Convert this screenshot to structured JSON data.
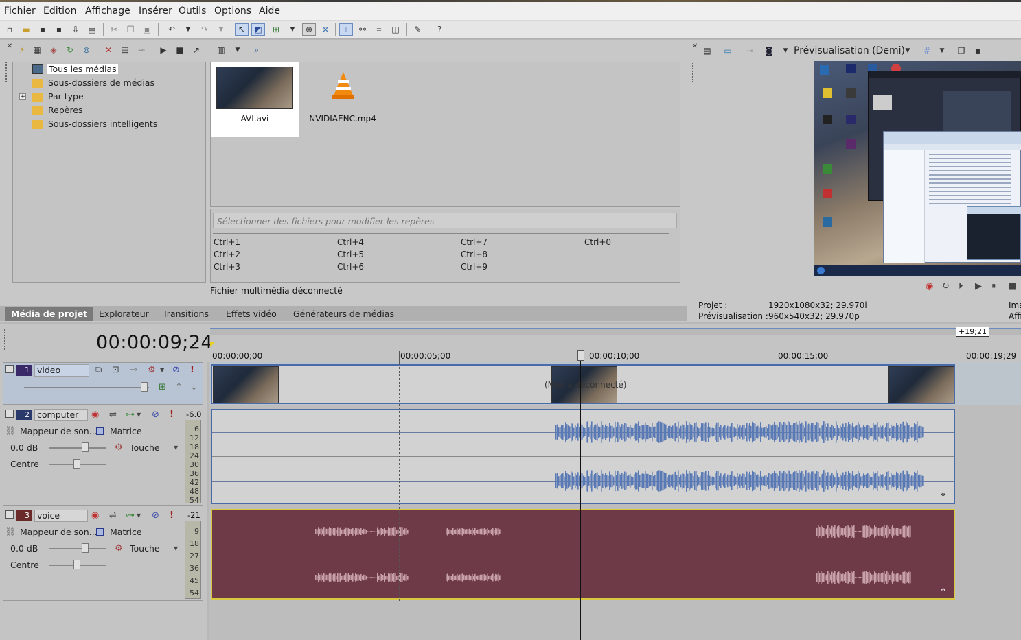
{
  "menu": [
    "Fichier",
    "Edition",
    "Affichage",
    "Insérer",
    "Outils",
    "Options",
    "Aide"
  ],
  "media_tree": [
    {
      "label": "Tous les médias",
      "selected": true,
      "icon": "media-icon"
    },
    {
      "label": "Sous-dossiers de médias",
      "icon": "folder-icon"
    },
    {
      "label": "Par type",
      "icon": "folder-icon",
      "expandable": true
    },
    {
      "label": "Repères",
      "icon": "folder-icon"
    },
    {
      "label": "Sous-dossiers intelligents",
      "icon": "folder-icon"
    }
  ],
  "files": [
    {
      "name": "AVI.avi",
      "icon": "video-thumbnail",
      "selected": true
    },
    {
      "name": "NVIDIAENC.mp4",
      "icon": "vlc-cone-icon"
    }
  ],
  "markers": {
    "placeholder": "Sélectionner des fichiers pour modifier les repères",
    "shortcuts": [
      "Ctrl+1",
      "Ctrl+4",
      "Ctrl+7",
      "Ctrl+0",
      "Ctrl+2",
      "Ctrl+5",
      "Ctrl+8",
      "Ctrl+3",
      "Ctrl+6",
      "Ctrl+9"
    ]
  },
  "status": "Fichier multimédia déconnecté",
  "tabs": [
    "Média de projet",
    "Explorateur",
    "Transitions",
    "Effets vidéo",
    "Générateurs de médias"
  ],
  "active_tab": "Média de projet",
  "preview": {
    "mode": "Prévisualisation (Demi)",
    "project_label": "Projet :",
    "project_value": "1920x1080x32; 29.970i",
    "preview_label": "Prévisualisation :",
    "preview_value": "960x540x32; 29.970p",
    "right_cut_1": "Ima",
    "right_cut_2": "Affi"
  },
  "timeline": {
    "timecode": "00:00:09;24",
    "end_marker": "+19;21",
    "ruler": [
      "00:00:00;00",
      "00:00:05;00",
      "00:00:10;00",
      "00:00:15;00",
      "00:00:19;29"
    ],
    "offline_label": "(Média déconnecté)"
  },
  "tracks": [
    {
      "num": "1",
      "name": "video",
      "type": "video",
      "color": "#3a2a6a"
    },
    {
      "num": "2",
      "name": "computer",
      "type": "audio",
      "color": "#2a3a6a",
      "level": "-6.0",
      "fx": "Mappeur de son...",
      "matrix": "Matrice",
      "volume": "0.0 dB",
      "touch": "Touche",
      "pan": "Centre",
      "meter": [
        "6",
        "12",
        "18",
        "24",
        "30",
        "36",
        "42",
        "48",
        "54"
      ],
      "wave_color": "#5a7ab5",
      "bg": "#d2d2d2"
    },
    {
      "num": "3",
      "name": "voice",
      "type": "audio",
      "color": "#6a2a2a",
      "level": "-21",
      "fx": "Mappeur de son...",
      "matrix": "Matrice",
      "volume": "0.0 dB",
      "touch": "Touche",
      "pan": "Centre",
      "meter": [
        "9",
        "18",
        "27",
        "36",
        "45",
        "54"
      ],
      "wave_color": "#c8a0a8",
      "bg": "#6e3a48"
    }
  ],
  "colors": {
    "accent": "#3a5a9a",
    "video_track_bg": "#c5cfdc",
    "voice_border": "#d8c840"
  }
}
